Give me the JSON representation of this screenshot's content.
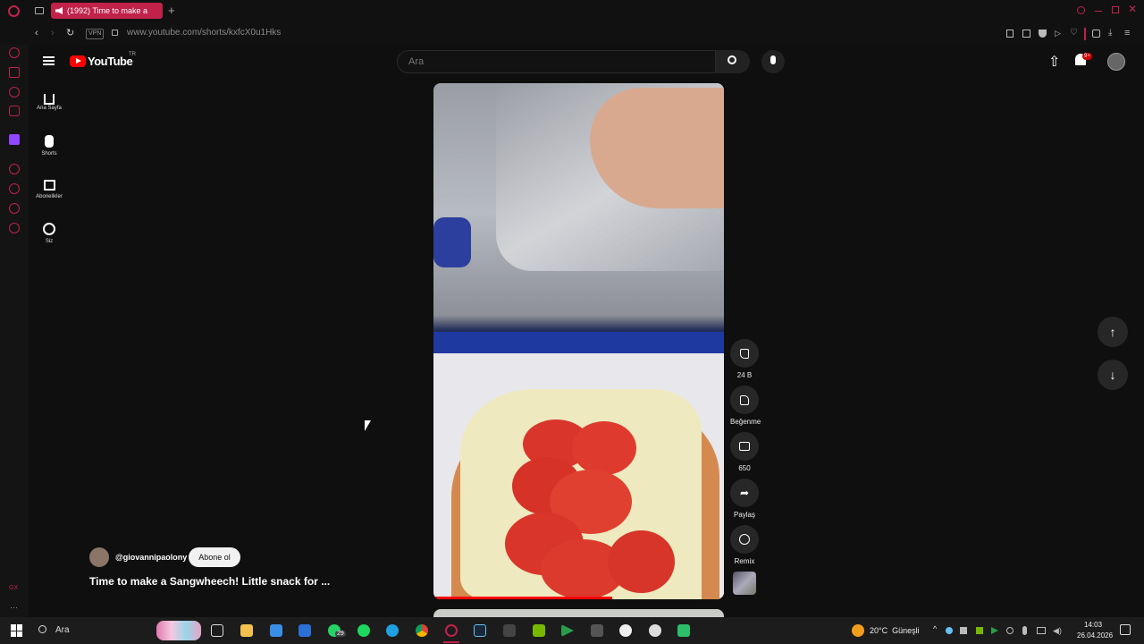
{
  "browser": {
    "tab_title": "(1992) Time to make a",
    "url": "www.youtube.com/shorts/kxfcX0u1Hks",
    "vpn_label": "VPN"
  },
  "youtube": {
    "logo_text": "YouTube",
    "logo_region": "TR",
    "search_placeholder": "Ara",
    "notification_badge": "9+",
    "nav": [
      {
        "label": "Ana Sayfa"
      },
      {
        "label": "Shorts"
      },
      {
        "label": "Abonelikler"
      },
      {
        "label": "Siz"
      }
    ],
    "actions": {
      "likes": "24 B",
      "dislike": "Beğenme",
      "comments": "650",
      "share": "Paylaş",
      "remix": "Remix"
    },
    "channel": {
      "handle": "@giovannipaolony",
      "subscribe_label": "Abone ol"
    },
    "video_title": "Time to make a Sangwheech! Little snack for ..."
  },
  "taskbar": {
    "search_placeholder": "Ara",
    "whatsapp_badge": "29",
    "weather": "20°C  Güneşli",
    "time": "14:03",
    "date": "26.04.2026"
  },
  "colors": {
    "accent": "#c0224a",
    "youtube_red": "#ff0000",
    "background": "#0f0f0f"
  }
}
